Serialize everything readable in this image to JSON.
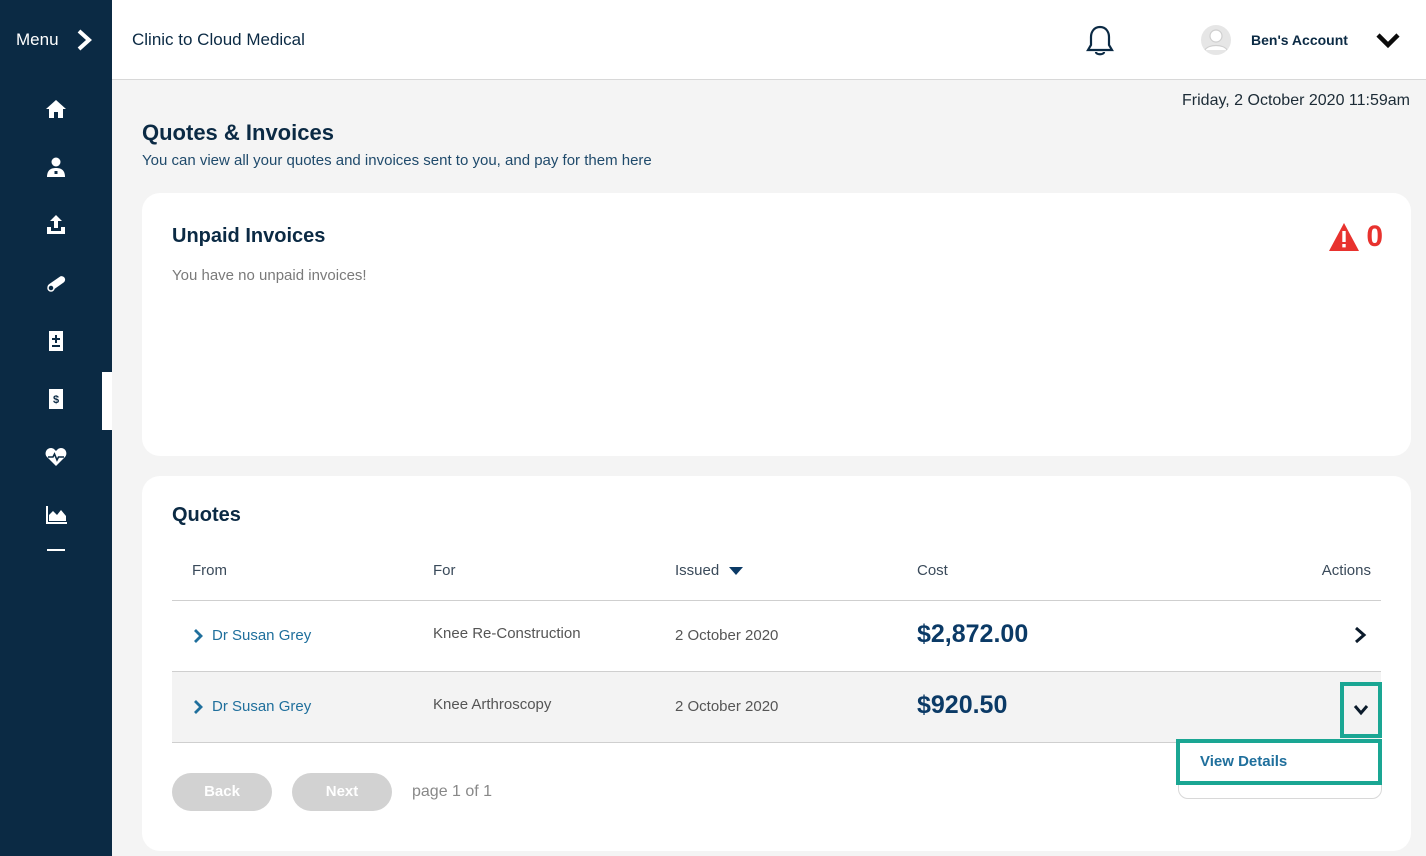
{
  "sidebar": {
    "menu_label": "Menu",
    "menu_icon": "chevron-right-icon",
    "items": [
      {
        "name": "home",
        "icon": "home-icon"
      },
      {
        "name": "doctors",
        "icon": "doctor-icon"
      },
      {
        "name": "uploads",
        "icon": "upload-icon"
      },
      {
        "name": "medications",
        "icon": "pill-icon"
      },
      {
        "name": "records",
        "icon": "medical-record-icon"
      },
      {
        "name": "quotes-invoices",
        "icon": "invoice-icon",
        "active": true
      },
      {
        "name": "health",
        "icon": "heart-pulse-icon"
      },
      {
        "name": "reports",
        "icon": "area-chart-icon"
      }
    ]
  },
  "header": {
    "clinic_name": "Clinic to Cloud Medical",
    "account_name": "Ben's Account"
  },
  "datetime": "Friday, 2 October 2020 11:59am",
  "page": {
    "title": "Quotes & Invoices",
    "subtitle": "You can view all your quotes and invoices sent to you, and pay for them here"
  },
  "unpaid": {
    "title": "Unpaid Invoices",
    "message": "You have no unpaid invoices!",
    "count": "0"
  },
  "quotes": {
    "title": "Quotes",
    "columns": {
      "from": "From",
      "for": "For",
      "issued": "Issued",
      "cost": "Cost",
      "actions": "Actions"
    },
    "rows": [
      {
        "from": "Dr Susan Grey",
        "for": "Knee Re-Construction",
        "issued": "2 October 2020",
        "cost": "$2,872.00"
      },
      {
        "from": "Dr Susan Grey",
        "for": "Knee Arthroscopy",
        "issued": "2 October 2020",
        "cost": "$920.50"
      }
    ],
    "dropdown_item": "View Details",
    "pagination": {
      "back": "Back",
      "next": "Next",
      "info": "page 1 of 1"
    }
  },
  "colors": {
    "sidebar_bg": "#0b2a44",
    "accent_teal": "#1aa693",
    "link_blue": "#1f6f9c",
    "warning_red": "#e8322e"
  }
}
